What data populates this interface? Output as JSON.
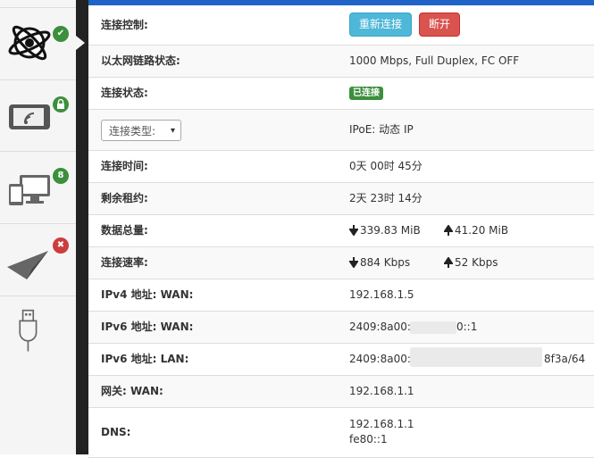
{
  "sidebar": {
    "items": [
      {
        "name": "internet",
        "badge": "✔",
        "badge_color": "#3c8f3c"
      },
      {
        "name": "wireless",
        "badge": "lock",
        "badge_color": "#3c8f3c"
      },
      {
        "name": "devices",
        "badge": "8",
        "badge_color": "#3c8f3c"
      },
      {
        "name": "vpn",
        "badge": "✖",
        "badge_color": "#cc3d3d"
      },
      {
        "name": "usb",
        "badge": ""
      }
    ]
  },
  "rows": {
    "control_label": "连接控制:",
    "reconnect_btn": "重新连接",
    "disconnect_btn": "断开",
    "eth_label": "以太网链路状态:",
    "eth_value": "1000 Mbps, Full Duplex, FC OFF",
    "status_label": "连接状态:",
    "status_value": "已连接",
    "type_select": "连接类型:",
    "type_value": "IPoE: 动态 IP",
    "time_label": "连接时间:",
    "time_value": "0天 00时 45分",
    "lease_label": "剩余租约:",
    "lease_value": "2天 23时 14分",
    "data_label": "数据总量:",
    "data_down": "339.83 MiB",
    "data_up": "41.20 MiB",
    "speed_label": "连接速率:",
    "speed_down": "884 Kbps",
    "speed_up": "52 Kbps",
    "ipv4_label": "IPv4 地址: WAN:",
    "ipv4_value": "192.168.1.5",
    "ipv6wan_label": "IPv6 地址: WAN:",
    "ipv6wan_prefix": "2409:8a00:",
    "ipv6wan_suffix": "0::1",
    "ipv6lan_label": "IPv6 地址: LAN:",
    "ipv6lan_prefix": "2409:8a00:",
    "ipv6lan_suffix": "8f3a/64",
    "gw_label": "网关: WAN:",
    "gw_value": "192.168.1.1",
    "dns_label": "DNS:",
    "dns1": "192.168.1.1",
    "dns2": "fe80::1"
  },
  "colors": {
    "accent": "#1f63c8",
    "success": "#3c8f3c",
    "danger": "#d9534f",
    "info": "#4fb7d8"
  }
}
